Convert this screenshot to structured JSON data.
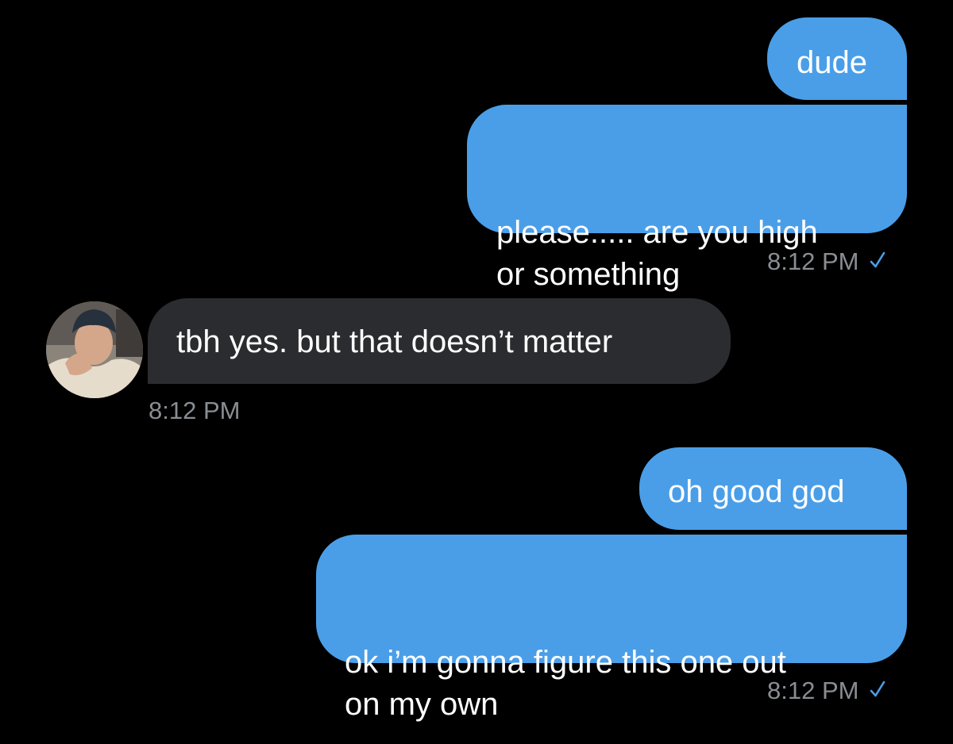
{
  "conversation": {
    "messages": [
      {
        "text": "dude"
      },
      {
        "text": "please..... are you high\nor something"
      },
      {
        "text": "tbh yes. but that doesn’t matter"
      },
      {
        "text": "oh good god"
      },
      {
        "text": "ok i’m gonna figure this one out\non my own"
      }
    ],
    "timestamps": [
      {
        "time": "8:12 PM"
      },
      {
        "time": "8:12 PM"
      },
      {
        "time": "8:12 PM"
      }
    ]
  },
  "colors": {
    "background": "#000000",
    "sent_bubble": "#4a9ee8",
    "received_bubble": "#2b2c2f",
    "timestamp_text": "#8a8d93",
    "read_check": "#4a9ee8"
  },
  "icons": {
    "read_receipt": "checkmark-icon",
    "contact_avatar": "avatar"
  }
}
